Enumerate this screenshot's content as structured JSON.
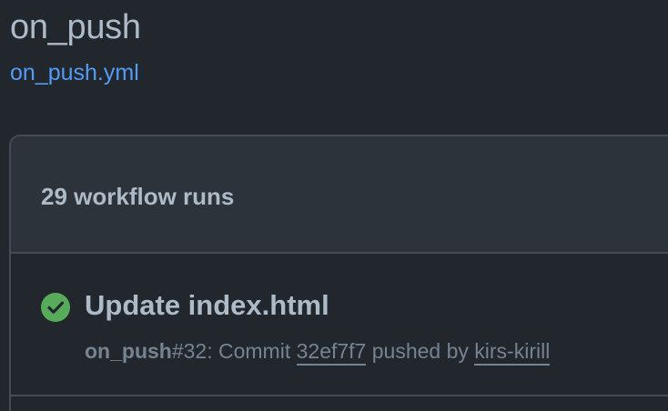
{
  "workflow": {
    "title": "on_push",
    "file_link": "on_push.yml"
  },
  "runs": {
    "count_label": "29 workflow runs",
    "items": [
      {
        "status": "success",
        "status_icon": "check-circle-fill-icon",
        "status_color": "#57ab5a",
        "title": "Update index.html",
        "workflow_name": "on_push",
        "run_number": "#32",
        "event_text": ": Commit ",
        "commit": "32ef7f7",
        "pushed_by_text": " pushed by ",
        "actor": "kirs-kirill"
      }
    ]
  },
  "colors": {
    "background": "#22272e",
    "header_background": "#2d333b",
    "border": "#444c56",
    "text": "#adbac7",
    "muted_text": "#768390",
    "link": "#539bf5"
  }
}
